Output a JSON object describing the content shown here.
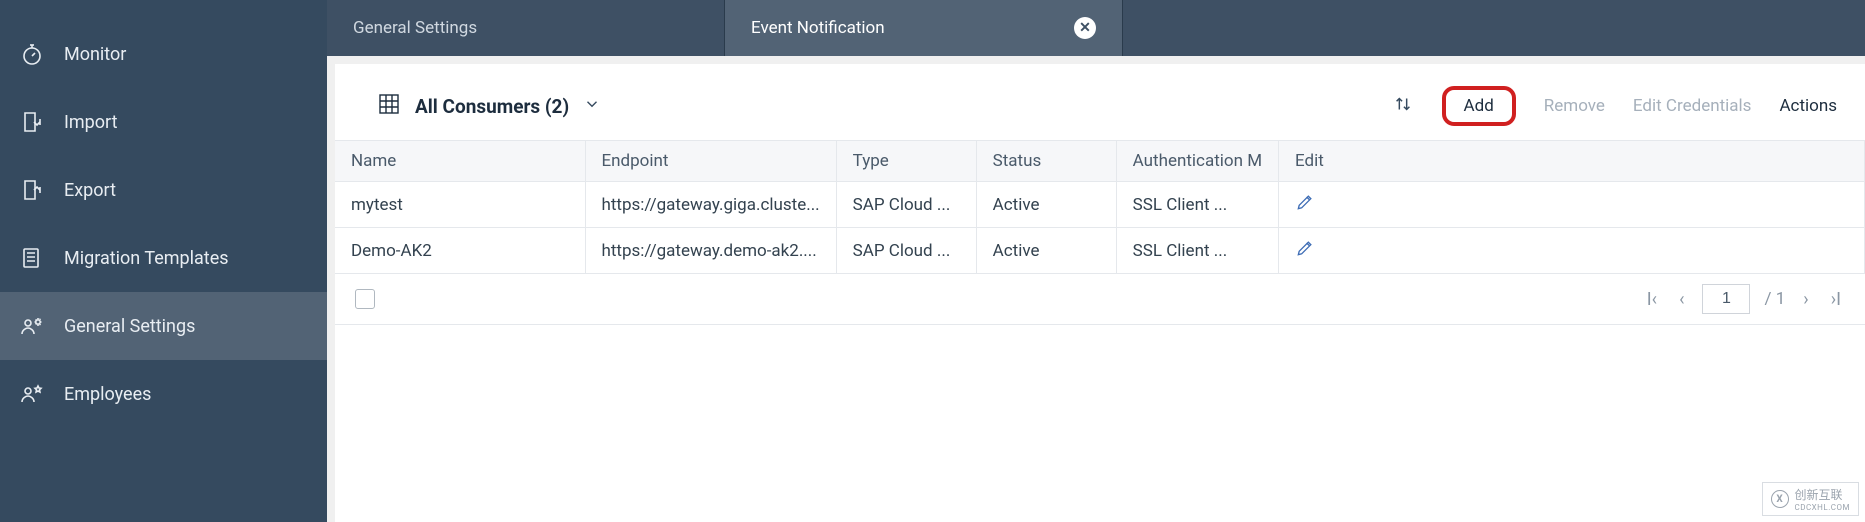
{
  "sidebar": {
    "items": [
      {
        "label": "Monitor",
        "icon": "stopwatch"
      },
      {
        "label": "Import",
        "icon": "import"
      },
      {
        "label": "Export",
        "icon": "export"
      },
      {
        "label": "Migration Templates",
        "icon": "templates"
      },
      {
        "label": "General Settings",
        "icon": "users-gear",
        "active": true
      },
      {
        "label": "Employees",
        "icon": "users-star"
      }
    ]
  },
  "tabs": [
    {
      "label": "General Settings",
      "active": false,
      "closable": false
    },
    {
      "label": "Event Notification",
      "active": true,
      "closable": true
    }
  ],
  "toolbar": {
    "title": "All Consumers  (2)",
    "actions": {
      "add": "Add",
      "remove": "Remove",
      "edit_credentials": "Edit Credentials",
      "actions": "Actions"
    }
  },
  "table": {
    "columns": [
      "Name",
      "Endpoint",
      "Type",
      "Status",
      "Authentication M",
      "Edit"
    ],
    "rows": [
      {
        "name": "mytest",
        "endpoint": "https://gateway.giga.cluste...",
        "type": "SAP Cloud ...",
        "status": "Active",
        "auth": "SSL Client ..."
      },
      {
        "name": "Demo-AK2",
        "endpoint": "https://gateway.demo-ak2....",
        "type": "SAP Cloud ...",
        "status": "Active",
        "auth": "SSL Client ..."
      }
    ]
  },
  "pagination": {
    "current": "1",
    "total": "/ 1"
  },
  "watermark": {
    "text": "创新互联",
    "sub": "CDCXHL.COM"
  }
}
